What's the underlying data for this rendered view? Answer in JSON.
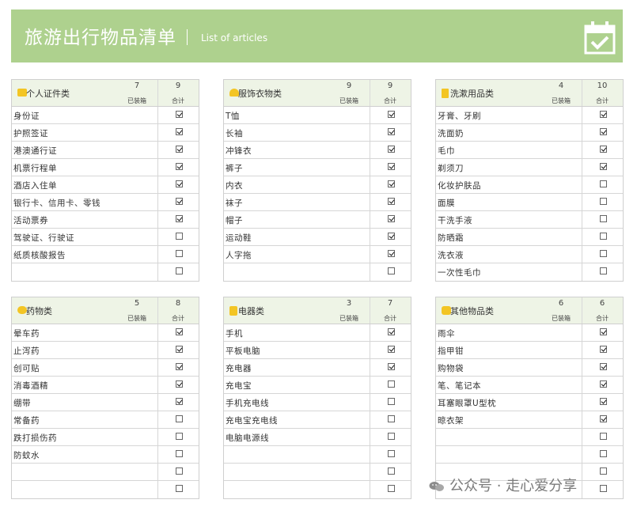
{
  "header": {
    "title": "旅游出行物品清单",
    "subtitle": "List of articles",
    "icon": "calendar-check-icon",
    "colors": {
      "banner": "#aed18e",
      "card_header": "#eef4e6"
    }
  },
  "column_labels": {
    "packed": "已装箱",
    "total": "合计"
  },
  "categories": [
    {
      "icon": "id-card-icon",
      "title": "个人证件类",
      "packed": "7",
      "total": "9",
      "items": [
        {
          "name": "身份证",
          "checked": true
        },
        {
          "name": "护照签证",
          "checked": true
        },
        {
          "name": "港澳通行证",
          "checked": true
        },
        {
          "name": "机票行程单",
          "checked": true
        },
        {
          "name": "酒店入住单",
          "checked": true
        },
        {
          "name": "银行卡、信用卡、零钱",
          "checked": true
        },
        {
          "name": "活动票券",
          "checked": true
        },
        {
          "name": "驾驶证、行驶证",
          "checked": false
        },
        {
          "name": "纸质核酸报告",
          "checked": false
        },
        {
          "name": "",
          "checked": false
        }
      ]
    },
    {
      "icon": "shirt-icon",
      "title": "服饰衣物类",
      "packed": "9",
      "total": "9",
      "items": [
        {
          "name": "T恤",
          "checked": true
        },
        {
          "name": "长袖",
          "checked": true
        },
        {
          "name": "冲锋衣",
          "checked": true
        },
        {
          "name": "裤子",
          "checked": true
        },
        {
          "name": "内衣",
          "checked": true
        },
        {
          "name": "袜子",
          "checked": true
        },
        {
          "name": "帽子",
          "checked": true
        },
        {
          "name": "运动鞋",
          "checked": true
        },
        {
          "name": "人字拖",
          "checked": true
        },
        {
          "name": "",
          "checked": false
        }
      ]
    },
    {
      "icon": "toiletries-icon",
      "title": "洗漱用品类",
      "packed": "4",
      "total": "10",
      "items": [
        {
          "name": "牙膏、牙刷",
          "checked": true
        },
        {
          "name": "洗面奶",
          "checked": true
        },
        {
          "name": "毛巾",
          "checked": true
        },
        {
          "name": "剃须刀",
          "checked": true
        },
        {
          "name": "化妆护肤品",
          "checked": false
        },
        {
          "name": "面膜",
          "checked": false
        },
        {
          "name": "干洗手液",
          "checked": false
        },
        {
          "name": "防晒霜",
          "checked": false
        },
        {
          "name": "洗衣液",
          "checked": false
        },
        {
          "name": "一次性毛巾",
          "checked": false
        }
      ]
    },
    {
      "icon": "medicine-icon",
      "title": "药物类",
      "packed": "5",
      "total": "8",
      "items": [
        {
          "name": "晕车药",
          "checked": true
        },
        {
          "name": "止泻药",
          "checked": true
        },
        {
          "name": "创可贴",
          "checked": true
        },
        {
          "name": "消毒酒精",
          "checked": true
        },
        {
          "name": "绷带",
          "checked": true
        },
        {
          "name": "常备药",
          "checked": false
        },
        {
          "name": "跌打损伤药",
          "checked": false
        },
        {
          "name": "防蚊水",
          "checked": false
        },
        {
          "name": "",
          "checked": false
        },
        {
          "name": "",
          "checked": false
        }
      ]
    },
    {
      "icon": "plug-icon",
      "title": "电器类",
      "packed": "3",
      "total": "7",
      "items": [
        {
          "name": "手机",
          "checked": true
        },
        {
          "name": "平板电脑",
          "checked": true
        },
        {
          "name": "充电器",
          "checked": true
        },
        {
          "name": "充电宝",
          "checked": false
        },
        {
          "name": "手机充电线",
          "checked": false
        },
        {
          "name": "充电宝充电线",
          "checked": false
        },
        {
          "name": "电脑电源线",
          "checked": false
        },
        {
          "name": "",
          "checked": false
        },
        {
          "name": "",
          "checked": false
        },
        {
          "name": "",
          "checked": false
        }
      ]
    },
    {
      "icon": "bag-icon",
      "title": "其他物品类",
      "packed": "6",
      "total": "6",
      "items": [
        {
          "name": "雨伞",
          "checked": true
        },
        {
          "name": "指甲钳",
          "checked": true
        },
        {
          "name": "购物袋",
          "checked": true
        },
        {
          "name": "笔、笔记本",
          "checked": true
        },
        {
          "name": "耳塞眼罩U型枕",
          "checked": true
        },
        {
          "name": "晾衣架",
          "checked": true
        },
        {
          "name": "",
          "checked": false
        },
        {
          "name": "",
          "checked": false
        },
        {
          "name": "",
          "checked": false
        },
        {
          "name": "",
          "checked": false
        }
      ]
    }
  ],
  "watermark": {
    "text": "公众号 · 走心爱分享",
    "icon": "wechat-icon"
  }
}
